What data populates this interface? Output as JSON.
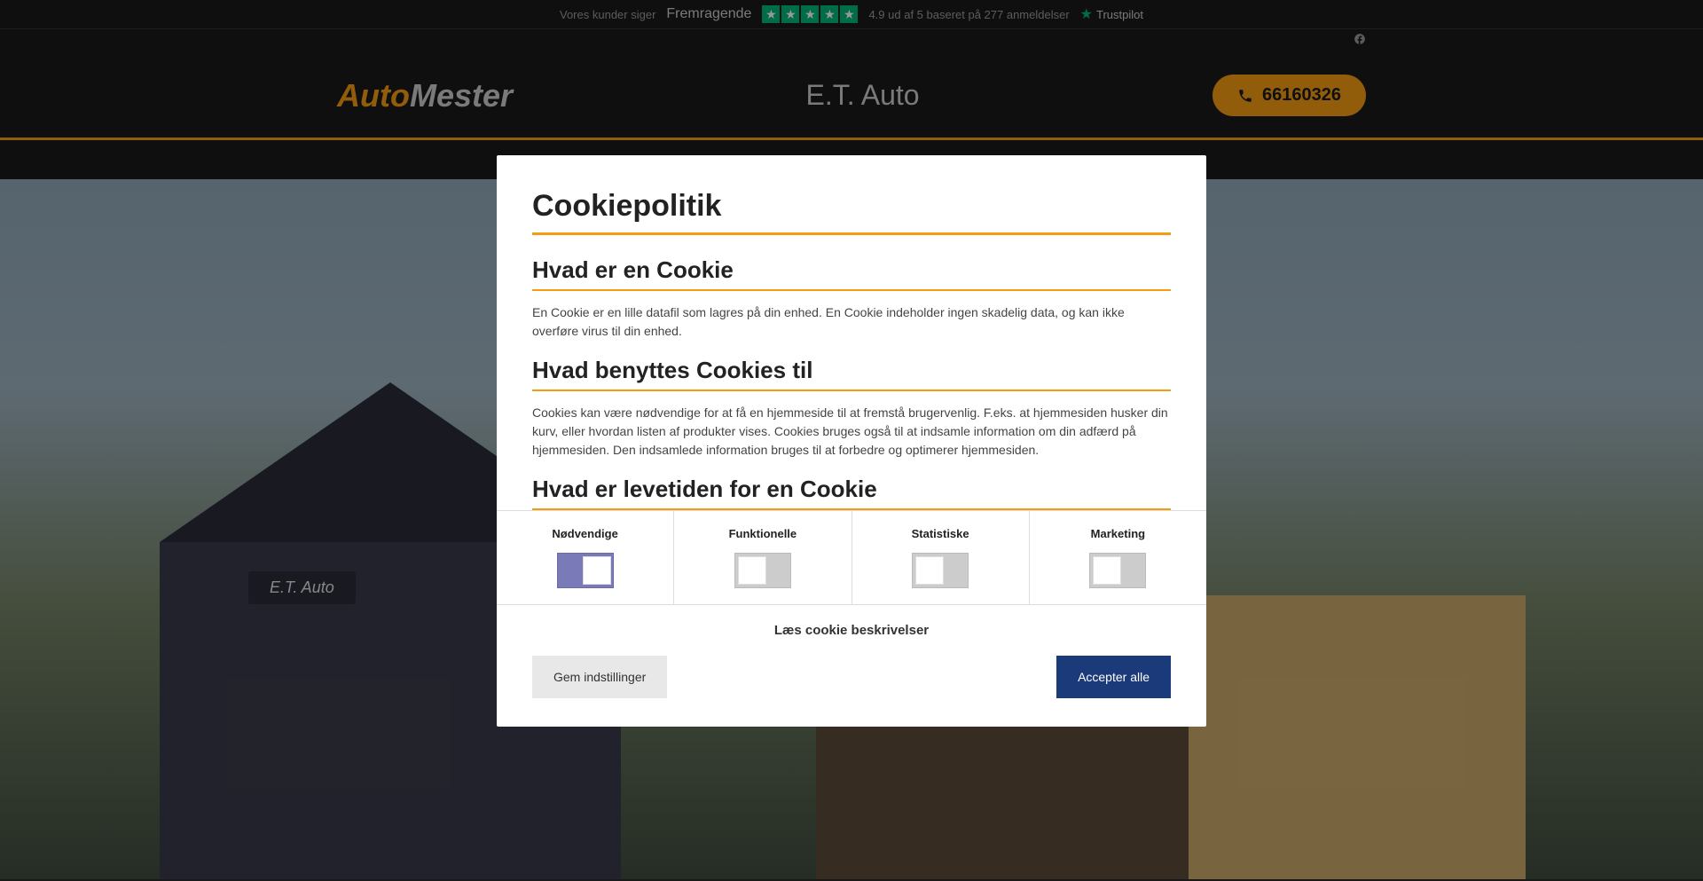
{
  "trustpilot": {
    "prefix": "Vores kunder siger",
    "rating_label": "Fremragende",
    "score_text": "4.9 ud af 5 baseret på 277 anmeldelser",
    "logo_text": "Trustpilot"
  },
  "header": {
    "logo_part1": "Auto",
    "logo_part2": "Mester",
    "company_name": "E.T. Auto",
    "phone": "66160326"
  },
  "hero": {
    "building_sign": "E.T. Auto"
  },
  "cookie_modal": {
    "title": "Cookiepolitik",
    "section1_title": "Hvad er en Cookie",
    "section1_text": "En Cookie er en lille datafil som lagres på din enhed. En Cookie indeholder ingen skadelig data, og kan ikke overføre virus til din enhed.",
    "section2_title": "Hvad benyttes Cookies til",
    "section2_text": "Cookies kan være nødvendige for at få en hjemmeside til at fremstå brugervenlig. F.eks. at hjemmesiden husker din kurv, eller hvordan listen af produkter vises. Cookies bruges også til at indsamle information om din adfærd på hjemmesiden. Den indsamlede information bruges til at forbedre og optimerer hjemmesiden.",
    "section3_title": "Hvad er levetiden for en Cookie",
    "toggles": [
      {
        "label": "Nødvendige",
        "active": true
      },
      {
        "label": "Funktionelle",
        "active": false
      },
      {
        "label": "Statistiske",
        "active": false
      },
      {
        "label": "Marketing",
        "active": false
      }
    ],
    "read_more": "Læs cookie beskrivelser",
    "save_button": "Gem indstillinger",
    "accept_button": "Accepter alle"
  }
}
